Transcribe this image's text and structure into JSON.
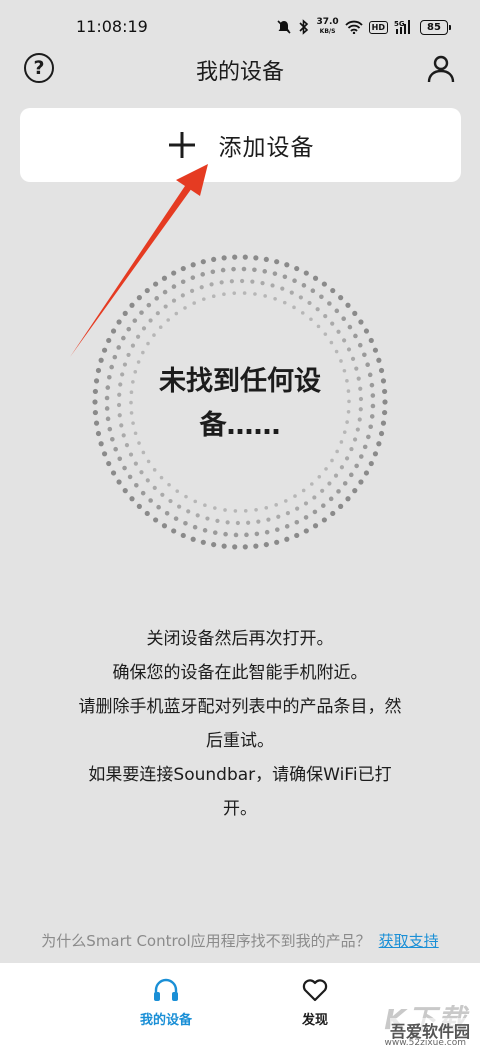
{
  "status_bar": {
    "time": "11:08:19",
    "network_speed_value": "37.0",
    "network_speed_unit": "KB/S",
    "hd_label": "HD",
    "signal_label": "5G",
    "battery": "85",
    "icons": [
      "mute-icon",
      "bluetooth-icon",
      "wifi-icon",
      "signal-icon",
      "battery-icon"
    ]
  },
  "header": {
    "title": "我的设备",
    "help_glyph": "?",
    "help_icon": "question-circle-icon",
    "account_icon": "user-icon"
  },
  "add_device": {
    "label": "添加设备",
    "icon": "plus-icon"
  },
  "empty_state": {
    "line1": "未找到任何设",
    "line2": "备……"
  },
  "instructions": [
    "关闭设备然后再次打开。",
    "确保您的设备在此智能手机附近。",
    "请删除手机蓝牙配对列表中的产品条目，然",
    "后重试。",
    "如果要连接Soundbar，请确保WiFi已打",
    "开。"
  ],
  "support": {
    "question": "为什么Smart Control应用程序找不到我的产品？",
    "link": "获取支持"
  },
  "bottom_nav": {
    "tabs": [
      {
        "label": "我的设备",
        "icon": "headphones-icon",
        "active": true
      },
      {
        "label": "发现",
        "icon": "heart-icon",
        "active": false
      }
    ]
  },
  "watermark": {
    "big": "K下载",
    "name": "吾爱软件园",
    "url": "www.52zixue.com"
  },
  "colors": {
    "background": "#e3e3e3",
    "accent": "#1a8fd6",
    "annotation_arrow": "#e53b22",
    "dots": "#8a8a8a"
  }
}
